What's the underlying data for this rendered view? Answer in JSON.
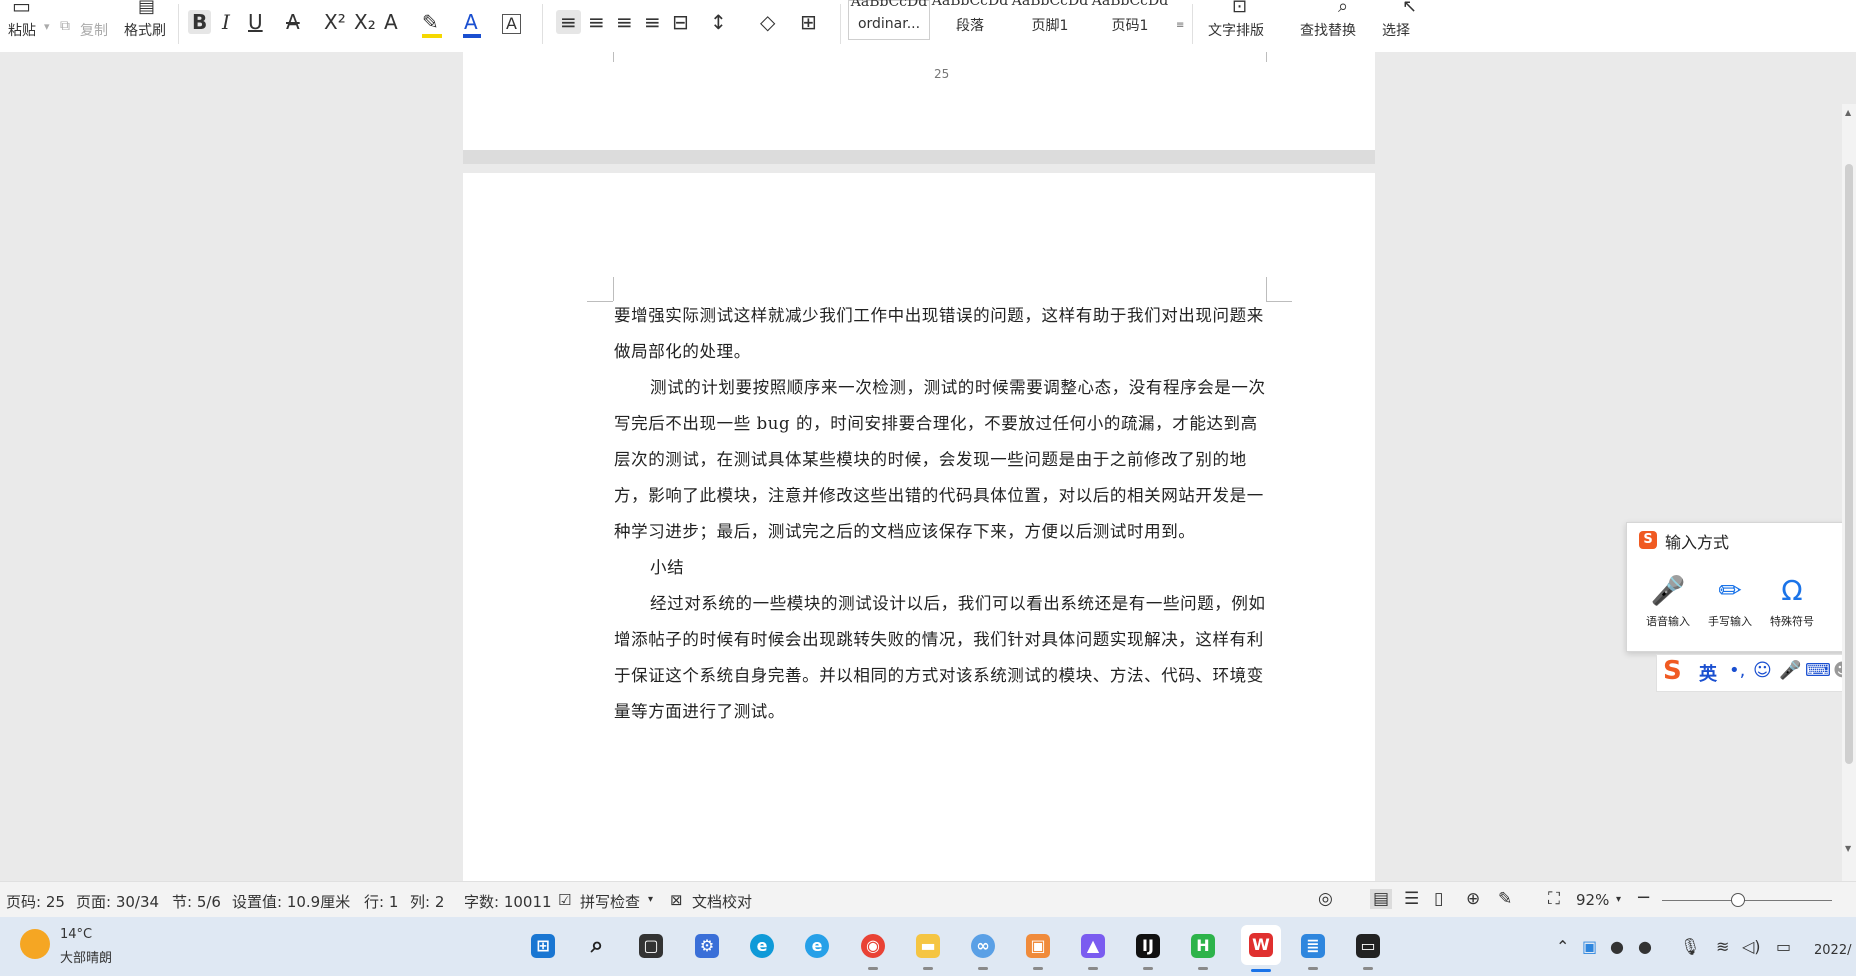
{
  "ribbon": {
    "paste": "粘贴",
    "copy": "复制",
    "format_painter": "格式刷",
    "styles": [
      {
        "sample": "AaBbCcDd",
        "name": "ordinar..."
      },
      {
        "sample": "AaBbCcDd",
        "name": "段落"
      },
      {
        "sample": "AaBbCcDd",
        "name": "页脚1"
      },
      {
        "sample": "AaBbCcDd",
        "name": "页码1"
      }
    ],
    "text_layout": "文字排版",
    "find_replace": "查找替换",
    "select": "选择"
  },
  "document": {
    "prev_page_number": "25",
    "paragraphs": [
      "要增强实际测试这样就减少我们工作中出现错误的问题，这样有助于我们对出现问题来做局部化的处理。",
      "测试的计划要按照顺序来一次检测，测试的时候需要调整心态，没有程序会是一次写完后不出现一些 bug 的，时间安排要合理化，不要放过任何小的疏漏，才能达到高层次的测试，在测试具体某些模块的时候，会发现一些问题是由于之前修改了别的地方，影响了此模块，注意并修改这些出错的代码具体位置，对以后的相关网站开发是一种学习进步；最后，测试完之后的文档应该保存下来，方便以后测试时用到。",
      "小结",
      "经过对系统的一些模块的测试设计以后，我们可以看出系统还是有一些问题，例如增添帖子的时候有时候会出现跳转失败的情况，我们针对具体问题实现解决，这样有利于保证这个系统自身完善。并以相同的方式对该系统测试的模块、方法、代码、环境变量等方面进行了测试。"
    ]
  },
  "ime_panel": {
    "title": "输入方式",
    "buttons": [
      "语音输入",
      "手写输入",
      "特殊符号"
    ],
    "bar_lang": "英"
  },
  "status": {
    "page_code": "页码: 25",
    "page": "页面: 30/34",
    "section": "节: 5/6",
    "set_value": "设置值: 10.9厘米",
    "row": "行: 1",
    "col": "列: 2",
    "word_count": "字数: 10011",
    "spell_check": "拼写检查",
    "proofread": "文档校对",
    "zoom": "92%"
  },
  "taskbar": {
    "temperature": "14°C",
    "weather": "大部晴朗",
    "clock": "2022/"
  },
  "colors": {
    "ribbon_bg": "#ffffff",
    "doc_bg": "#eaeaea",
    "status_bg": "#f3f3f3",
    "taskbar_bg": "#dfe8f3",
    "wps_red": "#e0302f",
    "accent_blue": "#1a73e8"
  }
}
